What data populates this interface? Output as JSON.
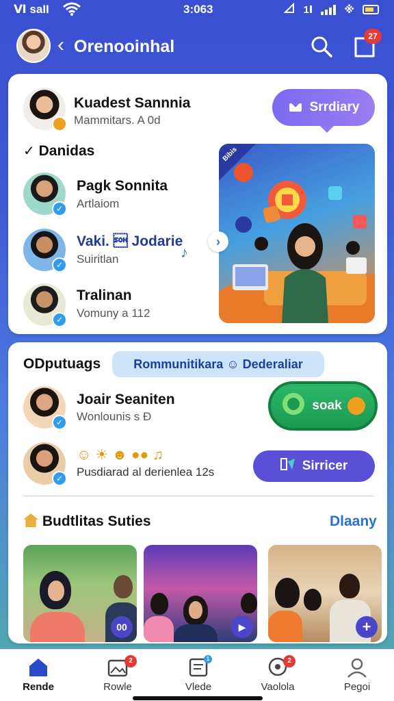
{
  "status": {
    "carrier": "Ⅵ saII",
    "time": "3:063",
    "signal_text": "1Ⅰ",
    "extra": "※"
  },
  "header": {
    "title": "Orenooinhal",
    "back": "‹",
    "notification_count": "27"
  },
  "card1": {
    "profile": {
      "name": "Kuadest Sannnia",
      "subtitle": "Mammitars. A 0d"
    },
    "study_button": "Srrdiary",
    "section_title": "Danidas",
    "people": [
      {
        "name": "Pagk Sonnita",
        "subtitle": "Artlaiom"
      },
      {
        "name": "Vaki. \u0001 Jodarie",
        "subtitle": "Suiritlan"
      },
      {
        "name": "Tralinan",
        "subtitle": "Vomuny a 112"
      }
    ],
    "promo_tag": "Bibis"
  },
  "card2": {
    "section_title": "ODputuags",
    "chip": "Rommunitikara ☺ Dederaliar",
    "people": [
      {
        "name": "Joair Seaniten",
        "subtitle": "Wonlounis s Ɖ"
      },
      {
        "name": "☺ ☀ ☻ ●● ♫",
        "subtitle": "Pusdiarad al derienlea 12s"
      }
    ],
    "green_button": "soak",
    "purple_button": "Sirricer",
    "suggest_title": "Budtlitas Suties",
    "see_all": "Dlaany",
    "thumbs": [
      {
        "badge": "00"
      },
      {
        "badge": "▶"
      },
      {
        "badge": "+"
      }
    ]
  },
  "nav": [
    {
      "label": "Rende",
      "badge": ""
    },
    {
      "label": "Rowle",
      "badge": "2"
    },
    {
      "label": "Vlede",
      "badge": "1"
    },
    {
      "label": "Vaolola",
      "badge": "2"
    },
    {
      "label": "Pegoi",
      "badge": ""
    }
  ],
  "colors": {
    "primary": "#3a4fd1",
    "accent_purple": "#7b6af0",
    "accent_green": "#1c9a4e",
    "verify": "#2f9cf0"
  }
}
